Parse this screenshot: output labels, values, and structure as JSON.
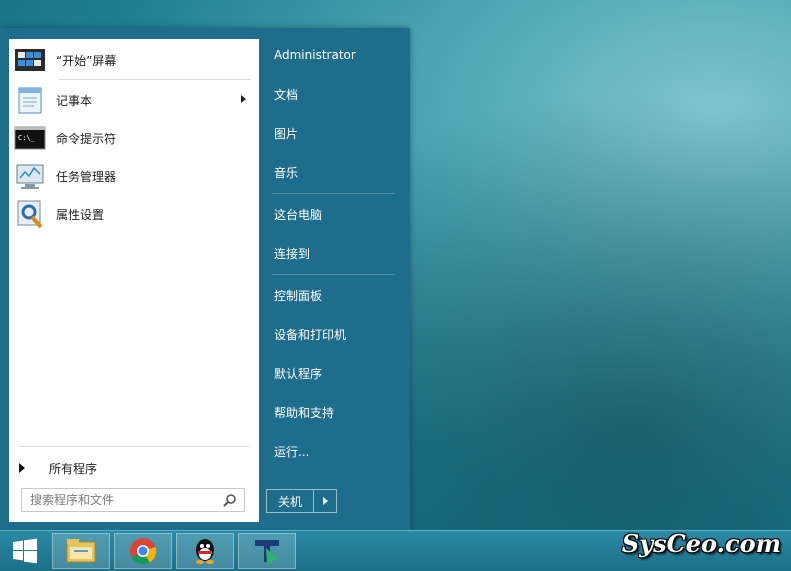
{
  "start_menu": {
    "programs": [
      {
        "label": "“开始”屏幕",
        "icon": "start-screen-icon"
      },
      {
        "label": "记事本",
        "icon": "notepad-icon",
        "has_submenu": true
      },
      {
        "label": "命令提示符",
        "icon": "cmd-icon"
      },
      {
        "label": "任务管理器",
        "icon": "task-manager-icon"
      },
      {
        "label": "属性设置",
        "icon": "settings-icon"
      }
    ],
    "all_programs": "所有程序",
    "search_placeholder": "搜索程序和文件",
    "right_items": [
      "Administrator",
      "文档",
      "图片",
      "音乐",
      "这台电脑",
      "连接到",
      "控制面板",
      "设备和打印机",
      "默认程序",
      "帮助和支持",
      "运行..."
    ],
    "shutdown_label": "关机"
  },
  "taskbar": {
    "buttons": [
      "file-explorer-icon",
      "chrome-icon",
      "qq-icon",
      "app-icon"
    ]
  },
  "watermark": "SysCeo.com",
  "colors": {
    "menu_bg": "#1f6d8d",
    "taskbar": "#1d6f88"
  }
}
